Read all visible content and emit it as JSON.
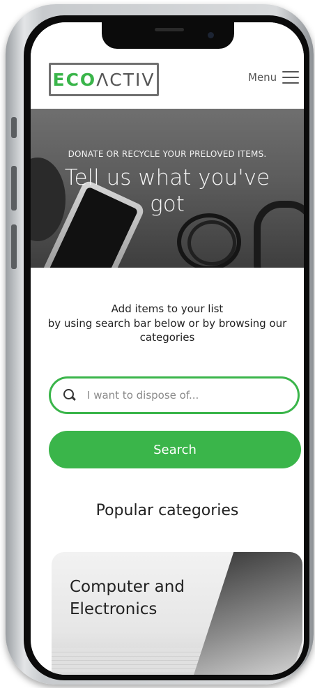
{
  "header": {
    "logo_prefix": "ECO",
    "logo_suffix": "ΛCTIV",
    "menu_label": "Menu"
  },
  "hero": {
    "subtitle": "DONATE OR RECYCLE YOUR PRELOVED ITEMS.",
    "title": "Tell us what you've got"
  },
  "intro": {
    "title": "Add items to your list",
    "body": "by using search bar below or by browsing our categories"
  },
  "search": {
    "placeholder": "I want to dispose of...",
    "button_label": "Search"
  },
  "categories": {
    "heading": "Popular categories",
    "items": [
      {
        "label": "Computer and Electronics"
      }
    ]
  },
  "colors": {
    "accent": "#3ab54a"
  }
}
